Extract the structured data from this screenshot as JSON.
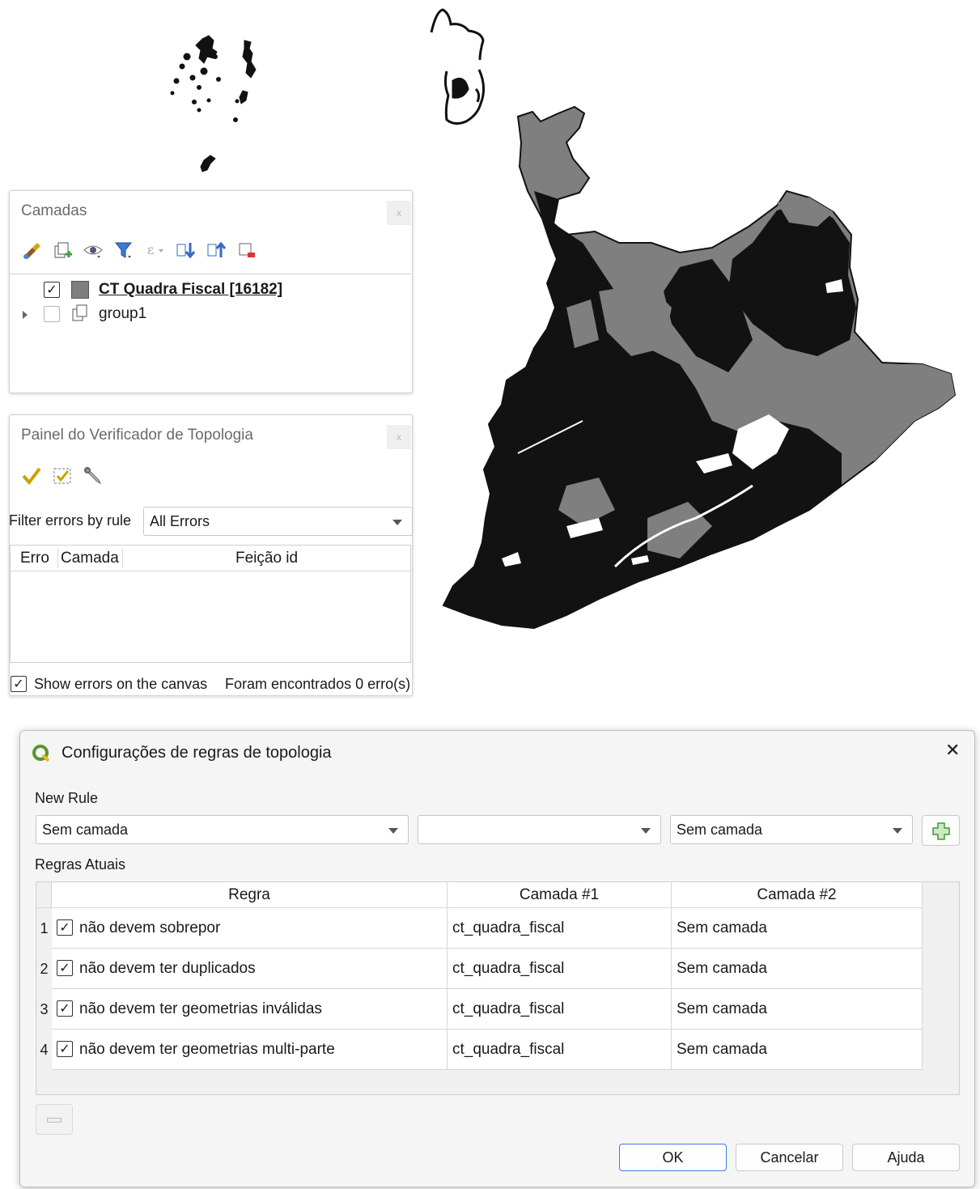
{
  "layers_panel": {
    "title": "Camadas",
    "close_label": "x",
    "layers": [
      {
        "name": "CT Quadra Fiscal [16182]",
        "checked": true,
        "type": "polygon-layer",
        "swatch_color": "#7f7f7f"
      },
      {
        "name": "group1",
        "checked": false,
        "type": "group"
      }
    ],
    "toolbar_icons": [
      "style-brush-icon",
      "add-group-icon",
      "visibility-icon",
      "filter-icon",
      "expression-filter-icon",
      "expand-all-icon",
      "collapse-all-icon",
      "remove-layer-icon"
    ]
  },
  "topology_panel": {
    "title": "Painel do Verificador de Topologia",
    "close_label": "x",
    "filter_label": "Filter errors by rule",
    "filter_value": "All Errors",
    "columns": [
      "Erro",
      "Camada",
      "Feição id"
    ],
    "show_errors_label": "Show errors on the canvas",
    "show_errors_checked": true,
    "status_text": "Foram encontrados 0 erro(s)",
    "toolbar_icons": [
      "validate-all-icon",
      "validate-extent-icon",
      "configure-rules-icon"
    ]
  },
  "rules_dialog": {
    "title": "Configurações de regras de topologia",
    "close_glyph": "✕",
    "new_rule_label": "New Rule",
    "layer1_combo": "Sem camada",
    "rule_combo": "",
    "layer2_combo": "Sem camada",
    "current_rules_label": "Regras Atuais",
    "columns": [
      "Regra",
      "Camada #1",
      "Camada #2"
    ],
    "rules": [
      {
        "num": "1",
        "checked": true,
        "rule": "não devem sobrepor",
        "layer1": "ct_quadra_fiscal",
        "layer2": "Sem camada"
      },
      {
        "num": "2",
        "checked": true,
        "rule": "não devem ter duplicados",
        "layer1": "ct_quadra_fiscal",
        "layer2": "Sem camada"
      },
      {
        "num": "3",
        "checked": true,
        "rule": "não devem ter geometrias inválidas",
        "layer1": "ct_quadra_fiscal",
        "layer2": "Sem camada"
      },
      {
        "num": "4",
        "checked": true,
        "rule": "não devem ter geometrias multi-parte",
        "layer1": "ct_quadra_fiscal",
        "layer2": "Sem camada"
      }
    ],
    "buttons": {
      "ok": "OK",
      "cancel": "Cancelar",
      "help": "Ajuda"
    }
  },
  "colors": {
    "map_fill": "#7f7f7f",
    "map_dense": "#111111",
    "accent": "#3d7fd6",
    "qgis_green": "#589632"
  }
}
